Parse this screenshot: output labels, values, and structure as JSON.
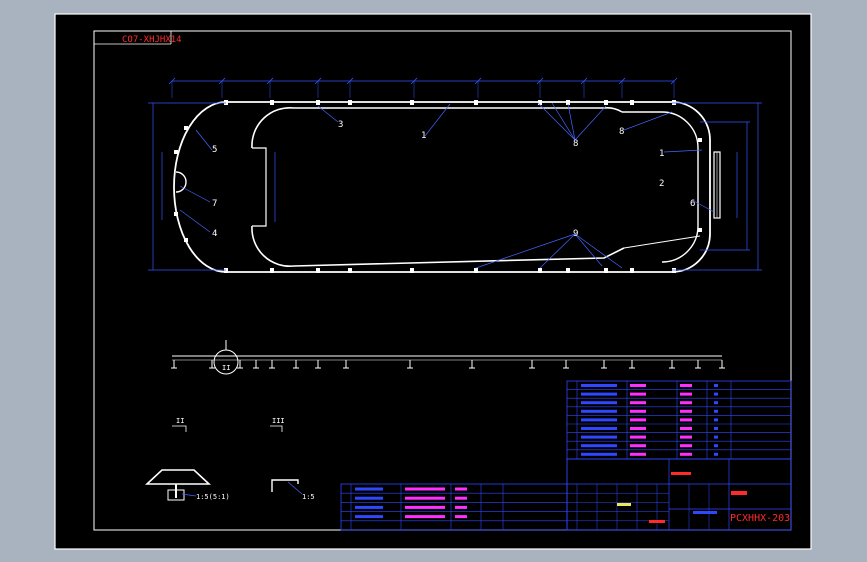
{
  "drawing": {
    "top_label": "CO7-XHJHX14",
    "drawing_number": "PCXHHX-203"
  },
  "colors": {
    "app_background": "#a9b2bf",
    "sheet": "#000000",
    "border": "#ffffff",
    "dimension": "#3355ff",
    "leader": "#4466ff",
    "red_text": "#ff2a2a",
    "table_lines": "#2f47ff",
    "magenta": "#ff30ff",
    "yellow": "#e8e85a"
  },
  "callouts": {
    "left": [
      "5",
      "7",
      "4"
    ],
    "top": [
      "3",
      "1"
    ],
    "right_top": [
      "8",
      "1"
    ],
    "right_side": [
      "2",
      "6"
    ],
    "top_bundle": "8",
    "bottom_bundle": "9"
  },
  "details": {
    "detail_circle_label": "II",
    "detail_view_1": "II",
    "detail_view_2": "III",
    "detail_1_note": "1:5(5:1)",
    "detail_2_note": "1:5"
  },
  "icons": [
    "section-cut-marker",
    "detail-circle-icon"
  ]
}
